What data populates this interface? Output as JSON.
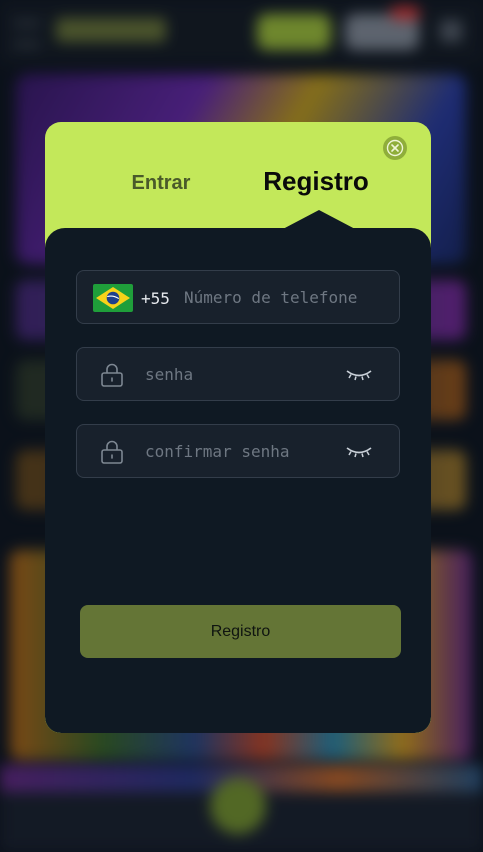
{
  "modal": {
    "tabs": {
      "login_label": "Entrar",
      "register_label": "Registro"
    },
    "close_icon": "close-icon",
    "phone": {
      "flag_icon": "brazil-flag-icon",
      "dial_code": "+55",
      "placeholder": "Número de telefone",
      "value": ""
    },
    "password": {
      "lock_icon": "lock-icon",
      "placeholder": "senha",
      "value": "",
      "toggle_icon": "eye-closed-icon"
    },
    "confirm_password": {
      "lock_icon": "lock-icon",
      "placeholder": "confirmar senha",
      "value": "",
      "toggle_icon": "eye-closed-icon"
    },
    "submit_label": "Registro"
  },
  "colors": {
    "accent": "#c3e85a",
    "panel": "#0f1923",
    "submit": "#647536"
  }
}
